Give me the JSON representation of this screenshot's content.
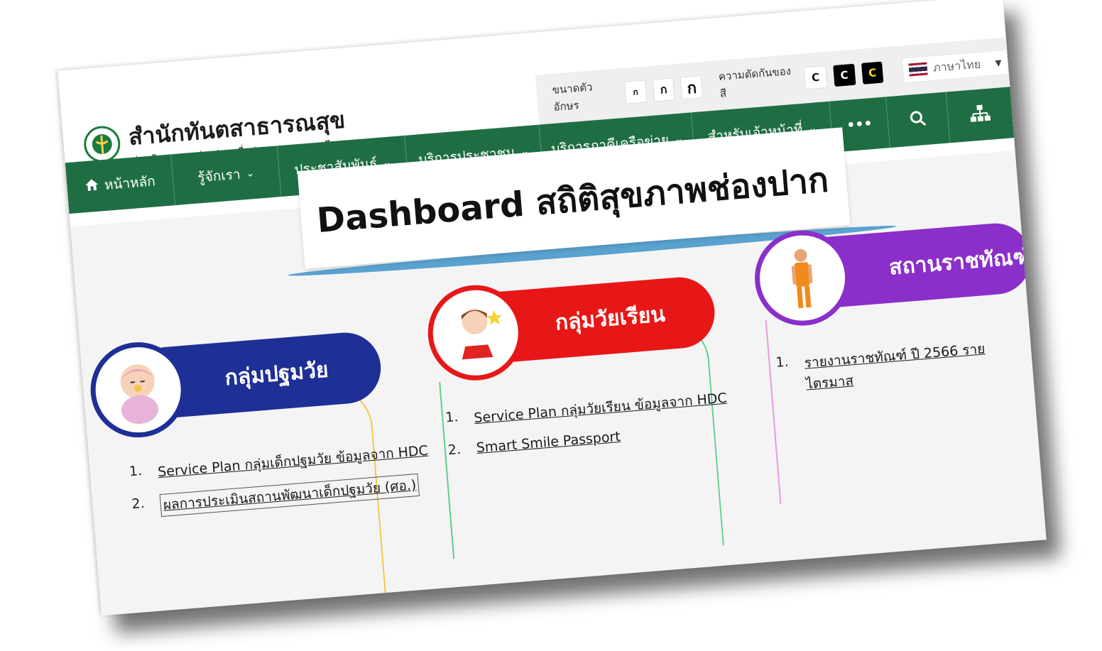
{
  "header": {
    "site_title": "สำนักทันตสาธารณสุข",
    "site_subtitle": "ส่งเสริมสุขภาพช่องปาก เพื่อประชาชนสุขภาพดี"
  },
  "accessibility": {
    "font_size_label": "ขนาดตัวอักษร",
    "font_sizes": [
      "ก",
      "ก",
      "ก"
    ],
    "contrast_label": "ความตัดกันของสี",
    "contrast_options": [
      "C",
      "C",
      "C"
    ],
    "language": "ภาษาไทย"
  },
  "nav": {
    "home": "หน้าหลัก",
    "items": [
      "รู้จักเรา",
      "ประชาสัมพันธ์",
      "บริการประชาชน",
      "บริการภาคีเครือข่าย",
      "สำหรับเจ้าหน้าที่"
    ],
    "more": "•••"
  },
  "banner": {
    "title": "Dashboard สถิติสุขภาพช่องปาก"
  },
  "sections": [
    {
      "title": "กลุ่มปฐมวัย",
      "color": "#1e2f95",
      "line_color": "#f2c744",
      "links": [
        {
          "num": "1.",
          "text": "Service Plan กลุ่มเด็กปฐมวัย ข้อมูลจาก HDC"
        },
        {
          "num": "2.",
          "text": "ผลการประเมินสถานพัฒนาเด็กปฐมวัย (ศอ.)"
        }
      ]
    },
    {
      "title": "กลุ่มวัยเรียน",
      "color": "#e81717",
      "line_color": "#5fcf8f",
      "links": [
        {
          "num": "1.",
          "text": "Service Plan กลุ่มวัยเรียน ข้อมูลจาก HDC"
        },
        {
          "num": "2.",
          "text": "Smart Smile Passport"
        }
      ]
    },
    {
      "title": "สถานราชทัณฑ์",
      "color": "#8a2fc9",
      "line_color": "#e99ae0",
      "links": [
        {
          "num": "1.",
          "text": "รายงานราชทัณฑ์ ปี 2566 รายไตรมาส"
        }
      ]
    }
  ],
  "colors": {
    "nav_green": "#1f6e43",
    "banner_line": "#5aa2cf"
  },
  "icons": [
    "home-icon",
    "search-icon",
    "sitemap-icon",
    "thai-flag-icon",
    "dropdown-caret-icon"
  ]
}
